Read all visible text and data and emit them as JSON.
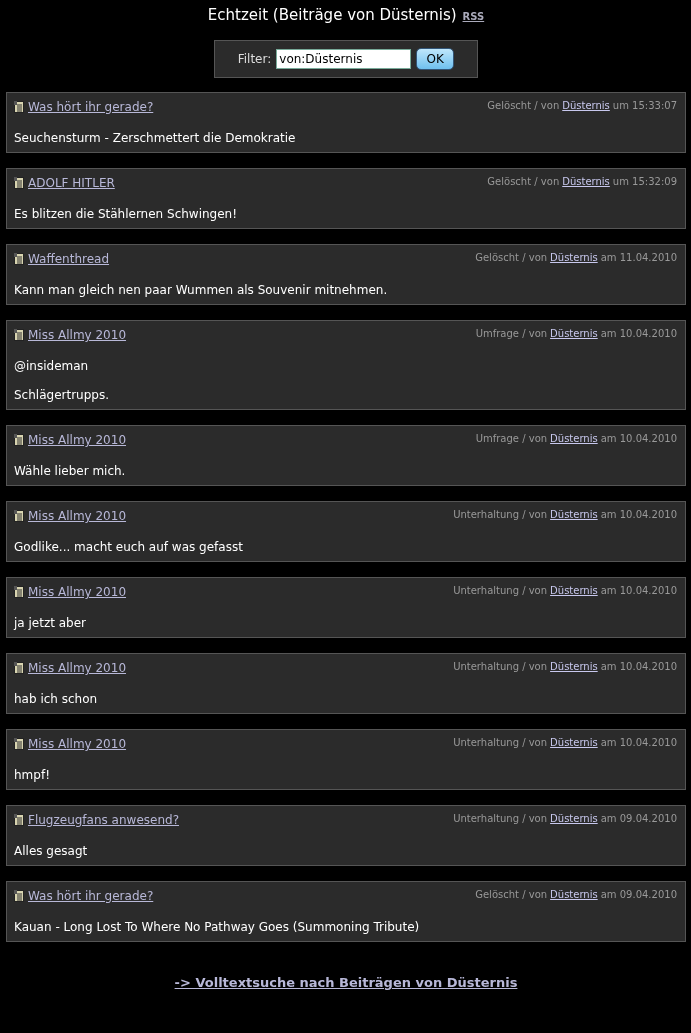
{
  "header": {
    "title": "Echtzeit (Beiträge von Düsternis)",
    "rss_link": "RSS"
  },
  "filter": {
    "label": "Filter:",
    "value": "von:Düsternis",
    "button": "OK"
  },
  "posts": [
    {
      "title": "Was hört ihr gerade?",
      "meta_before": "Gelöscht / von",
      "author": "Düsternis",
      "meta_after": "um 15:33:07",
      "paragraphs": [
        "Seuchensturm - Zerschmettert die Demokratie"
      ]
    },
    {
      "title": "ADOLF HITLER",
      "meta_before": "Gelöscht / von",
      "author": "Düsternis",
      "meta_after": "um 15:32:09",
      "paragraphs": [
        "Es blitzen die Stählernen Schwingen!"
      ]
    },
    {
      "title": "Waffenthread",
      "meta_before": "Gelöscht / von",
      "author": "Düsternis",
      "meta_after": "am 11.04.2010",
      "paragraphs": [
        "Kann man gleich nen paar Wummen als Souvenir mitnehmen."
      ]
    },
    {
      "title": "Miss Allmy 2010",
      "meta_before": "Umfrage / von",
      "author": "Düsternis",
      "meta_after": "am 10.04.2010",
      "paragraphs": [
        "@insideman",
        "Schlägertrupps."
      ]
    },
    {
      "title": "Miss Allmy 2010",
      "meta_before": "Umfrage / von",
      "author": "Düsternis",
      "meta_after": "am 10.04.2010",
      "paragraphs": [
        "Wähle lieber mich."
      ]
    },
    {
      "title": "Miss Allmy 2010",
      "meta_before": "Unterhaltung / von",
      "author": "Düsternis",
      "meta_after": "am 10.04.2010",
      "paragraphs": [
        "Godlike... macht euch auf was gefasst"
      ]
    },
    {
      "title": "Miss Allmy 2010",
      "meta_before": "Unterhaltung / von",
      "author": "Düsternis",
      "meta_after": "am 10.04.2010",
      "paragraphs": [
        "ja jetzt aber"
      ]
    },
    {
      "title": "Miss Allmy 2010",
      "meta_before": "Unterhaltung / von",
      "author": "Düsternis",
      "meta_after": "am 10.04.2010",
      "paragraphs": [
        "hab ich schon"
      ]
    },
    {
      "title": "Miss Allmy 2010",
      "meta_before": "Unterhaltung / von",
      "author": "Düsternis",
      "meta_after": "am 10.04.2010",
      "paragraphs": [
        "hmpf!"
      ]
    },
    {
      "title": "Flugzeugfans anwesend?",
      "meta_before": "Unterhaltung / von",
      "author": "Düsternis",
      "meta_after": "am 09.04.2010",
      "paragraphs": [
        "Alles gesagt"
      ]
    },
    {
      "title": "Was hört ihr gerade?",
      "meta_before": "Gelöscht / von",
      "author": "Düsternis",
      "meta_after": "am 09.04.2010",
      "paragraphs": [
        "Kauan - Long Lost To Where No Pathway Goes (Summoning Tribute)"
      ]
    }
  ],
  "footer_link": "-> Volltextsuche nach Beiträgen von Düsternis"
}
